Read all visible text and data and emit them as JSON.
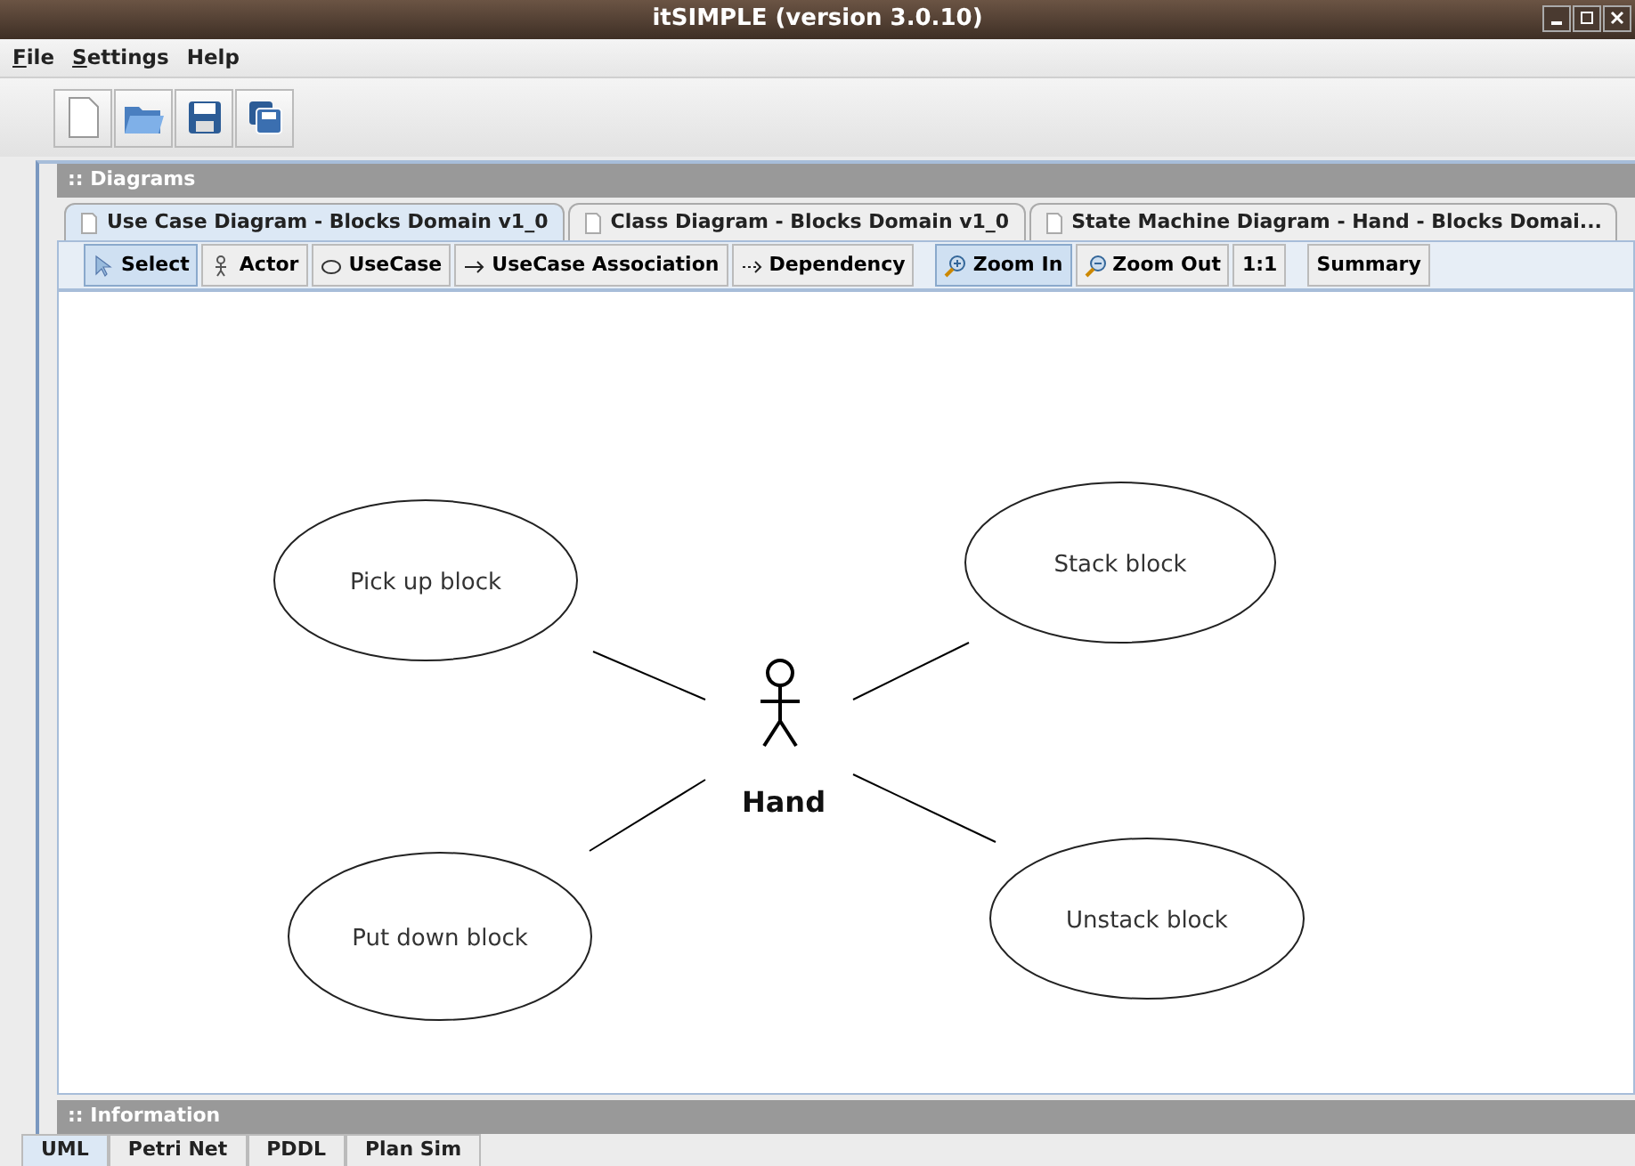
{
  "window": {
    "title": "itSIMPLE (version 3.0.10)"
  },
  "menu": [
    {
      "label": "File",
      "mnemonic_underlined": true
    },
    {
      "label": "Settings",
      "mnemonic_underlined": true
    },
    {
      "label": "Help",
      "mnemonic_underlined": false
    }
  ],
  "diagrams_panel": {
    "title": ":: Diagrams",
    "tabs": [
      {
        "label": "Use Case Diagram - Blocks Domain v1_0",
        "selected": true
      },
      {
        "label": "Class Diagram - Blocks Domain v1_0",
        "selected": false
      },
      {
        "label": "State Machine Diagram - Hand - Blocks Domai...",
        "selected": false
      }
    ],
    "tools": [
      {
        "label": "Select",
        "kind": "pointer",
        "selected": true
      },
      {
        "label": "Actor",
        "kind": "actor",
        "selected": false
      },
      {
        "label": "UseCase",
        "kind": "oval",
        "selected": false
      },
      {
        "label": "UseCase Association",
        "kind": "arrow",
        "selected": false
      },
      {
        "label": "Dependency",
        "kind": "dotted-arrow",
        "selected": false
      },
      {
        "label": "Zoom In",
        "kind": "zoom-in",
        "selected": true
      },
      {
        "label": "Zoom Out",
        "kind": "zoom-out",
        "selected": false
      },
      {
        "label": "1:1",
        "kind": "plain",
        "selected": false
      },
      {
        "label": "Summary",
        "kind": "plain",
        "selected": false
      }
    ],
    "diagram": {
      "actor": {
        "name": "Hand"
      },
      "use_cases": [
        {
          "name": "Pick up block"
        },
        {
          "name": "Stack block"
        },
        {
          "name": "Put down block"
        },
        {
          "name": "Unstack block"
        }
      ]
    }
  },
  "information_panel": {
    "title": ":: Information"
  },
  "bottom_tabs": [
    {
      "label": "UML",
      "selected": true
    },
    {
      "label": "Petri Net",
      "selected": false
    },
    {
      "label": "PDDL",
      "selected": false
    },
    {
      "label": "Plan Sim",
      "selected": false
    }
  ]
}
